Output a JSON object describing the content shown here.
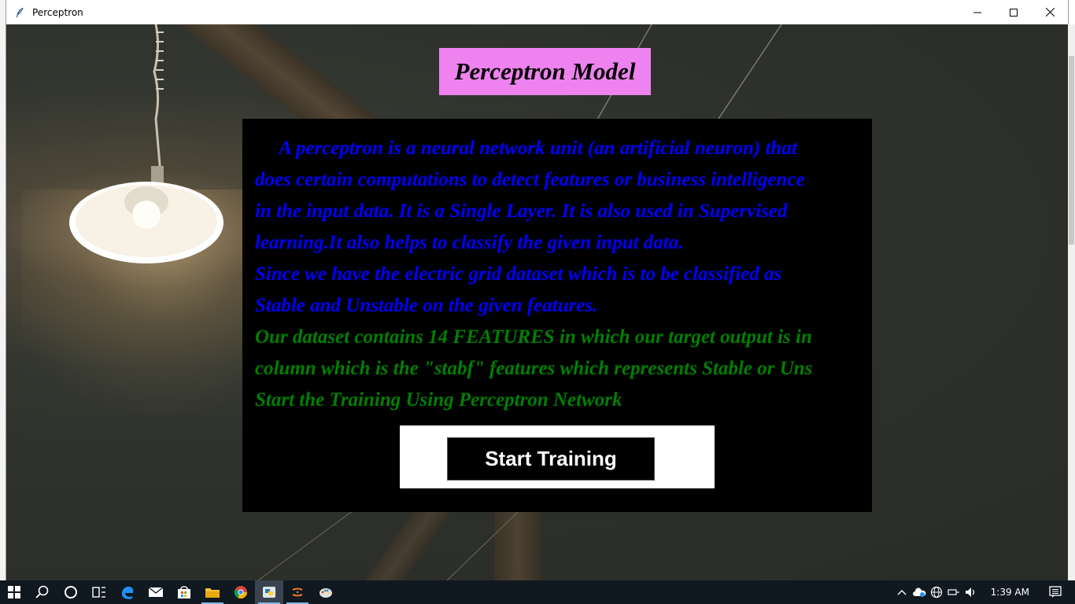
{
  "window": {
    "title": "Perceptron"
  },
  "header": {
    "title": "Perceptron Model",
    "background": "#ee82ee"
  },
  "description": {
    "lines": [
      {
        "text": "     A perceptron is a neural network unit (an artificial neuron) that",
        "color": "#0000ff"
      },
      {
        "text": "does certain computations to detect features or business intelligence",
        "color": "#0000ff"
      },
      {
        "text": "in the input data. It is a Single Layer. It is also used in Supervised",
        "color": "#0000ff"
      },
      {
        "text": "learning.It also helps to classify the given input data.",
        "color": "#0000ff"
      },
      {
        "text": "Since we have the electric grid dataset which is to be classified as",
        "color": "#0000ff"
      },
      {
        "text": "Stable and Unstable on the given features.",
        "color": "#0000ff"
      },
      {
        "text": "Our dataset contains 14 FEATURES in which our target output is in",
        "color": "#008000"
      },
      {
        "text": "column which is the \"stabf\" features which represents Stable or Uns",
        "color": "#008000"
      },
      {
        "text": "Start the Training Using Perceptron Network",
        "color": "#008000"
      }
    ]
  },
  "actions": {
    "start_label": "Start Training"
  },
  "taskbar": {
    "apps": [
      "windows-start",
      "search",
      "cortana",
      "task-view",
      "edge",
      "mail",
      "store",
      "file-explorer",
      "chrome",
      "python-idle",
      "jupyter",
      "paint"
    ],
    "clock": "1:39 AM"
  }
}
